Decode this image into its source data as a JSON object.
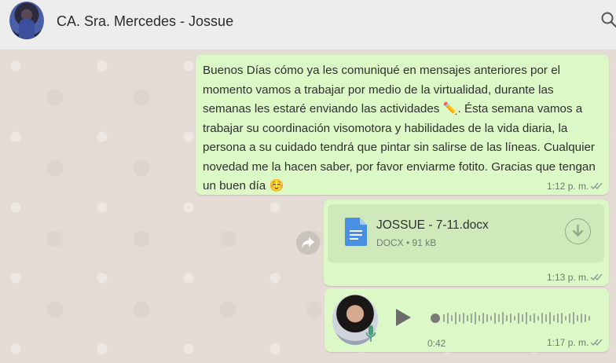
{
  "header": {
    "chat_title": "CA. Sra. Mercedes - Jossue"
  },
  "messages": [
    {
      "type": "text",
      "text": "Buenos Días cómo ya les comuniqué en mensajes anteriores por el\nmomento vamos a trabajar por medio de la virtualidad, durante las\nsemanas les estaré enviando   las actividades ✏️. Ésta semana vamos a\ntrabajar su coordinación visomotora y habilidades de la vida diaria, la\npersona a su  cuidado tendrá que pintar sin salirse de las líneas. Cualquier\nnovedad me la hacen saber, por favor enviarme fotito. Gracias que tengan\nun buen día ☺️",
      "time": "1:12 p. m."
    },
    {
      "type": "document",
      "file_name": "JOSSUE - 7-11.docx",
      "file_meta": "DOCX • 91 kB",
      "time": "1:13 p. m."
    },
    {
      "type": "voice",
      "duration": "0:42",
      "time": "1:17 p. m."
    }
  ],
  "colors": {
    "outgoing_bubble": "#dcf8c6",
    "read_ticks": "#8e9e8e",
    "doc_icon": "#4a90e2"
  },
  "icons": [
    "search-icon",
    "forward-icon",
    "document-icon",
    "download-icon",
    "play-icon",
    "mic-icon",
    "double-check-icon"
  ]
}
